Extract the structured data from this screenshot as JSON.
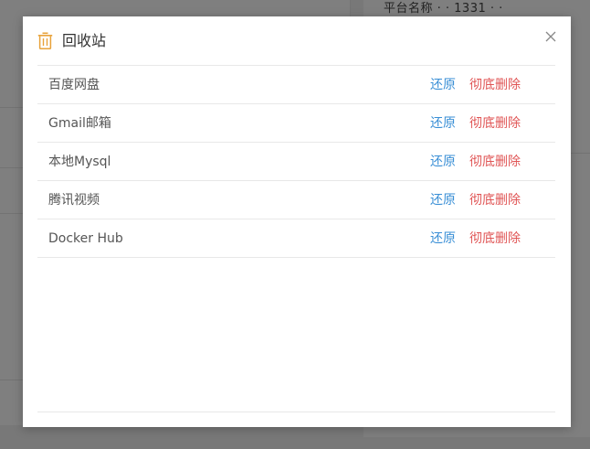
{
  "background": {
    "peek_text": "平台名称 · · 1331 · ·"
  },
  "modal": {
    "title": "回收站",
    "restore_label": "还原",
    "delete_label": "彻底删除",
    "items": [
      {
        "name": "百度网盘"
      },
      {
        "name": "Gmail邮箱"
      },
      {
        "name": "本地Mysql"
      },
      {
        "name": "腾讯视频"
      },
      {
        "name": "Docker Hub"
      }
    ]
  },
  "colors": {
    "accent_icon": "#e8a23a",
    "restore_link": "#3a8fd6",
    "delete_link": "#e05555"
  },
  "icons": {
    "title_icon": "trash-icon",
    "close_icon": "close-icon"
  }
}
